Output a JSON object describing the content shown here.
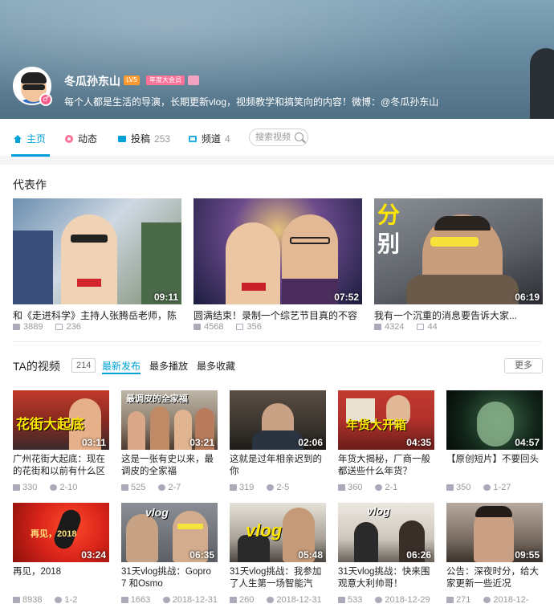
{
  "profile": {
    "name": "冬瓜孙东山",
    "level_badge": "LV5",
    "vip_badge": "年度大会员",
    "sign": "每个人都是生活的导演，长期更新vlog，视频教学和搞笑向的内容！微博：@冬瓜孙东山"
  },
  "nav": {
    "tabs": [
      {
        "label": "主页",
        "count": ""
      },
      {
        "label": "动态",
        "count": ""
      },
      {
        "label": "投稿",
        "count": "253"
      },
      {
        "label": "频道",
        "count": "4"
      }
    ],
    "search_placeholder": "搜索视频"
  },
  "masterpieces": {
    "title": "代表作",
    "items": [
      {
        "title": "和《走进科学》主持人张腾岳老师，陈",
        "duration": "09:11",
        "plays": "3889",
        "danmaku": "236"
      },
      {
        "title": "圆满结束！录制一个综艺节目真的不容",
        "duration": "07:52",
        "plays": "4568",
        "danmaku": "356"
      },
      {
        "title": "我有一个沉重的消息要告诉大家...",
        "duration": "06:19",
        "plays": "4324",
        "danmaku": "44",
        "overlay": "分\n别"
      }
    ]
  },
  "videos": {
    "title": "TA的视频",
    "count": "214",
    "sorts": [
      "最新发布",
      "最多播放",
      "最多收藏"
    ],
    "more": "更多",
    "items": [
      {
        "title": "广州花街大起底：现在的花街和以前有什么区",
        "duration": "03:11",
        "plays": "330",
        "date": "2-10",
        "overlay": "花街大起底"
      },
      {
        "title": "这是一张有史以来，最调皮的全家福",
        "duration": "03:21",
        "plays": "525",
        "date": "2-7",
        "overlay": "最调皮的全家福"
      },
      {
        "title": "这就是过年相亲迟到的你",
        "duration": "02:06",
        "plays": "319",
        "date": "2-5"
      },
      {
        "title": "年货大揭秘，厂商一般都送些什么年货？",
        "duration": "04:35",
        "plays": "360",
        "date": "2-1",
        "overlay": "年货大开箱"
      },
      {
        "title": "【原创短片】不要回头",
        "duration": "04:57",
        "plays": "350",
        "date": "1-27"
      },
      {
        "title": "再见，2018",
        "duration": "03:24",
        "plays": "8938",
        "date": "1-2",
        "overlay": "再见，2018"
      },
      {
        "title": "31天vlog挑战：Gopro 7 和Osmo",
        "duration": "06:35",
        "plays": "1663",
        "date": "2018-12-31",
        "overlay": "vlog"
      },
      {
        "title": "31天vlog挑战：我参加了人生第一场智能汽",
        "duration": "05:48",
        "plays": "260",
        "date": "2018-12-31",
        "overlay": "vlog"
      },
      {
        "title": "31天vlog挑战：快来围观意大利帅哥！",
        "duration": "06:26",
        "plays": "533",
        "date": "2018-12-29",
        "overlay": "vlog"
      },
      {
        "title": "公告：深夜时分，给大家更新一些近况",
        "duration": "09:55",
        "plays": "271",
        "date": "2018-12-"
      }
    ]
  },
  "colors": {
    "accent": "#00a1d6",
    "vip": "#fb7299",
    "level": "#ff9a2e"
  }
}
